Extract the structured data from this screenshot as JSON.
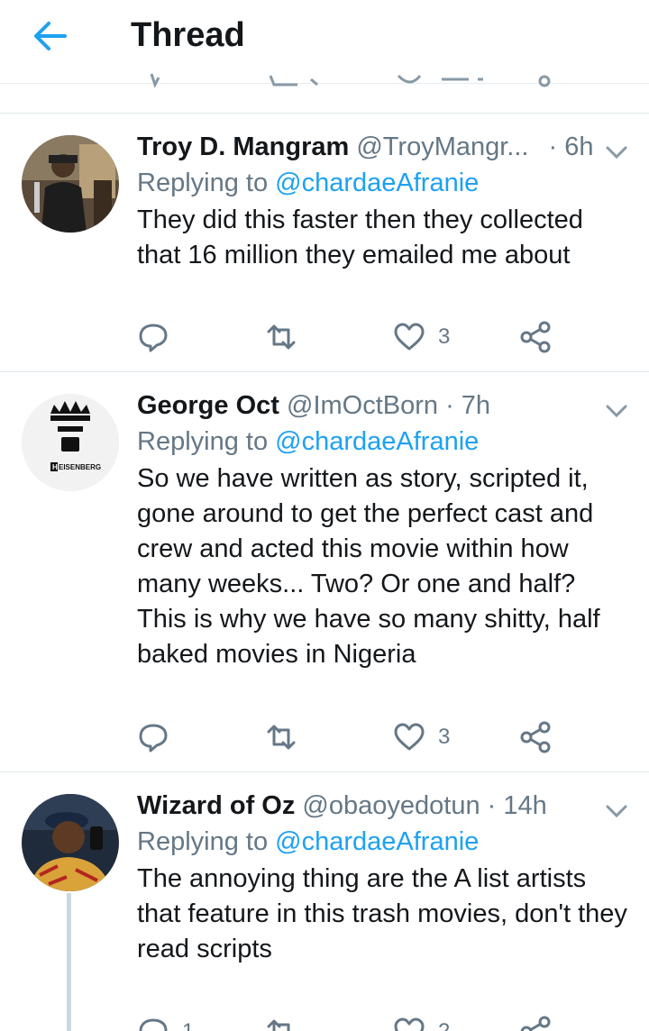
{
  "header": {
    "title": "Thread",
    "back_icon": "arrow-left-icon"
  },
  "tweets": [
    {
      "name": "Troy D. Mangram",
      "handle": "@TroyMangr...",
      "time": "· 6h",
      "replying_prefix": "Replying to ",
      "replying_to": "@chardaeAfranie",
      "text": "They did this faster then they collected that 16 million they emailed me about",
      "like_count": "3"
    },
    {
      "name": "George Oct",
      "handle": "@ImOctBorn",
      "time": "· 7h",
      "replying_prefix": "Replying to ",
      "replying_to": "@chardaeAfranie",
      "text": "So we have written as story, scripted it, gone around to get the perfect cast and crew and acted this movie within how many weeks... Two? Or one and half? This is why we have so many shitty, half baked movies in Nigeria",
      "like_count": "3",
      "avatar_text": "EISENBERG",
      "avatar_letter": "H"
    },
    {
      "name": "Wizard of Oz",
      "handle": "@obaoyedotun",
      "time": "· 14h",
      "replying_prefix": "Replying to ",
      "replying_to": "@chardaeAfranie",
      "text": "The annoying thing are the A list artists that feature in this trash movies, don't they read scripts",
      "reply_count": "1",
      "like_count": "2"
    }
  ],
  "colors": {
    "accent": "#1da1f2",
    "muted": "#657786",
    "text": "#14171a",
    "divider": "#e1e8ed"
  }
}
